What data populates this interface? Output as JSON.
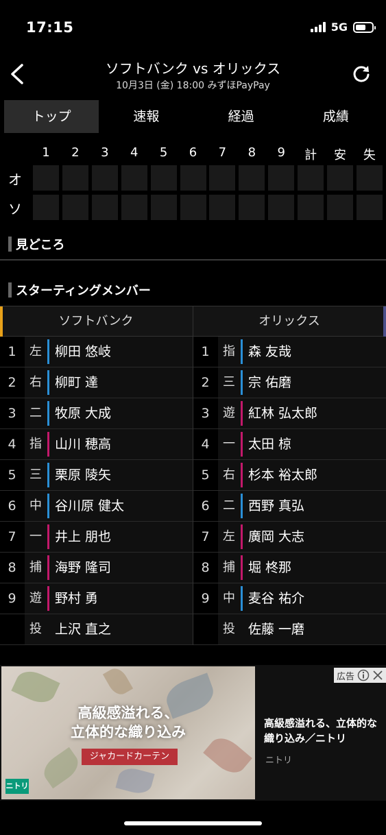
{
  "status_bar": {
    "time": "17:15",
    "network": "5G"
  },
  "header": {
    "title": "ソフトバンク vs オリックス",
    "subtitle": "10月3日 (金) 18:00 みずほPayPay"
  },
  "tabs": [
    "トップ",
    "速報",
    "経過",
    "成績"
  ],
  "scoreboard": {
    "columns": [
      "1",
      "2",
      "3",
      "4",
      "5",
      "6",
      "7",
      "8",
      "9",
      "計",
      "安",
      "失"
    ],
    "teams": [
      "オ",
      "ソ"
    ]
  },
  "sections": {
    "highlights": "見どころ",
    "starting_members": "スターティングメンバー"
  },
  "lineup": {
    "home_team": "ソフトバンク",
    "away_team": "オリックス",
    "home": [
      {
        "num": "1",
        "pos": "左",
        "name": "柳田 悠岐",
        "hand": "blue"
      },
      {
        "num": "2",
        "pos": "右",
        "name": "柳町 達",
        "hand": "blue"
      },
      {
        "num": "3",
        "pos": "二",
        "name": "牧原 大成",
        "hand": "blue"
      },
      {
        "num": "4",
        "pos": "指",
        "name": "山川 穂高",
        "hand": "pink"
      },
      {
        "num": "5",
        "pos": "三",
        "name": "栗原 陵矢",
        "hand": "blue"
      },
      {
        "num": "6",
        "pos": "中",
        "name": "谷川原 健太",
        "hand": "blue"
      },
      {
        "num": "7",
        "pos": "一",
        "name": "井上 朋也",
        "hand": "pink"
      },
      {
        "num": "8",
        "pos": "捕",
        "name": "海野 隆司",
        "hand": "pink"
      },
      {
        "num": "9",
        "pos": "遊",
        "name": "野村 勇",
        "hand": "pink"
      },
      {
        "num": "",
        "pos": "投",
        "name": "上沢 直之",
        "hand": "none"
      }
    ],
    "away": [
      {
        "num": "1",
        "pos": "指",
        "name": "森 友哉",
        "hand": "blue"
      },
      {
        "num": "2",
        "pos": "三",
        "name": "宗 佑磨",
        "hand": "blue"
      },
      {
        "num": "3",
        "pos": "遊",
        "name": "紅林 弘太郎",
        "hand": "pink"
      },
      {
        "num": "4",
        "pos": "一",
        "name": "太田 椋",
        "hand": "pink"
      },
      {
        "num": "5",
        "pos": "右",
        "name": "杉本 裕太郎",
        "hand": "pink"
      },
      {
        "num": "6",
        "pos": "二",
        "name": "西野 真弘",
        "hand": "blue"
      },
      {
        "num": "7",
        "pos": "左",
        "name": "廣岡 大志",
        "hand": "pink"
      },
      {
        "num": "8",
        "pos": "捕",
        "name": "堀 柊那",
        "hand": "pink"
      },
      {
        "num": "9",
        "pos": "中",
        "name": "麦谷 祐介",
        "hand": "blue"
      },
      {
        "num": "",
        "pos": "投",
        "name": "佐藤 一磨",
        "hand": "none"
      }
    ]
  },
  "ad": {
    "badge": "広告",
    "image_copy_line1": "高級感溢れる、",
    "image_copy_line2": "立体的な織り込み",
    "image_pill": "ジャカードカーテン",
    "image_logo": "ニトリ",
    "text": "高級感溢れる、立体的な織り込み／ニトリ",
    "brand": "ニトリ"
  },
  "colors": {
    "home_accent": "#e8a11a",
    "away_accent": "#4a4f8a",
    "bat_blue": "#2a8fd6",
    "bat_pink": "#c2186a"
  }
}
